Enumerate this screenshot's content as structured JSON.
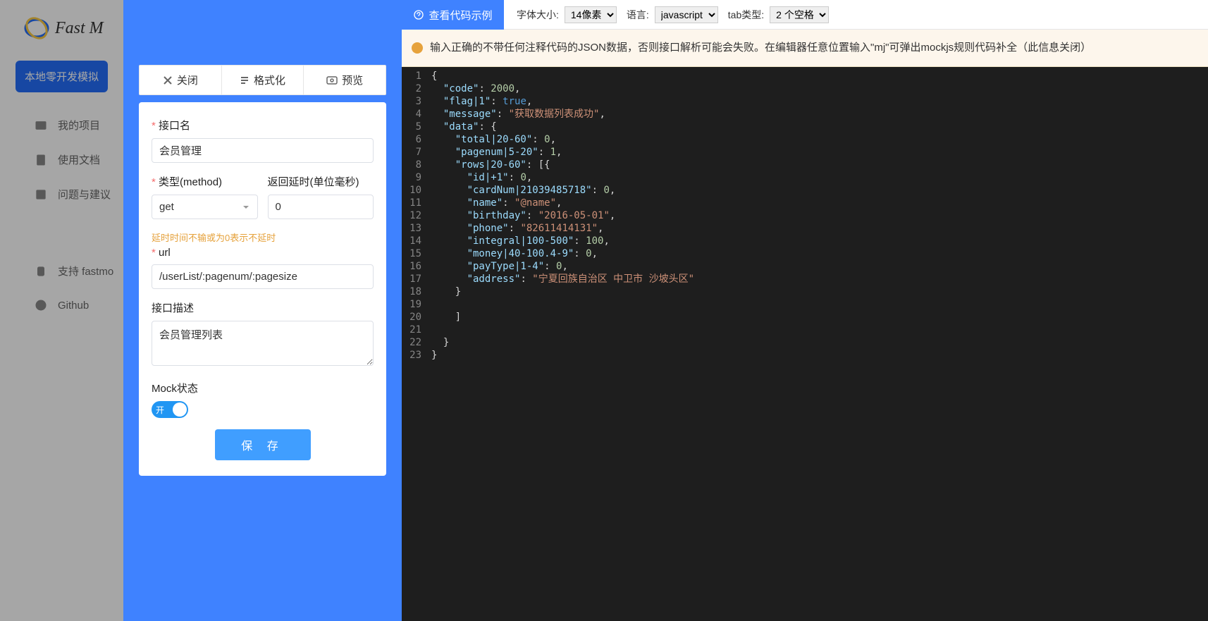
{
  "brand": {
    "name": "Fast M"
  },
  "sidebar": {
    "primary_btn": "本地零开发模拟",
    "items": [
      {
        "label": "我的项目"
      },
      {
        "label": "使用文档"
      },
      {
        "label": "问题与建议"
      },
      {
        "label": "支持 fastmo"
      },
      {
        "label": "Github"
      }
    ]
  },
  "drawer": {
    "toolbar": {
      "close": "关闭",
      "format": "格式化",
      "preview": "预览"
    },
    "labels": {
      "api_name": "接口名",
      "method": "类型(method)",
      "delay": "返回延时(单位毫秒)",
      "delay_hint": "延时时间不输或为0表示不延时",
      "url": "url",
      "desc": "接口描述",
      "mock_state": "Mock状态"
    },
    "values": {
      "api_name": "会员管理",
      "method": "get",
      "delay": "0",
      "url": "/userList/:pagenum/:pagesize",
      "desc": "会员管理列表",
      "switch_text": "开"
    },
    "save": "保 存"
  },
  "topbar": {
    "example_btn": "查看代码示例",
    "font_label": "字体大小:",
    "font_value": "14像素",
    "lang_label": "语言:",
    "lang_value": "javascript",
    "tab_label": "tab类型:",
    "tab_value": "2 个空格"
  },
  "warning": "输入正确的不带任何注释代码的JSON数据，否则接口解析可能会失败。在编辑器任意位置输入\"mj\"可弹出mockjs规则代码补全（此信息关闭）",
  "code_lines": [
    "{",
    "  \"code\": 2000,",
    "  \"flag|1\": true,",
    "  \"message\": \"获取数据列表成功\",",
    "  \"data\": {",
    "    \"total|20-60\": 0,",
    "    \"pagenum|5-20\": 1,",
    "    \"rows|20-60\": [{",
    "      \"id|+1\": 0,",
    "      \"cardNum|21039485718\": 0,",
    "      \"name\": \"@name\",",
    "      \"birthday\": \"2016-05-01\",",
    "      \"phone\": \"82611414131\",",
    "      \"integral|100-500\": 100,",
    "      \"money|40-100.4-9\": 0,",
    "      \"payType|1-4\": 0,",
    "      \"address\": \"宁夏回族自治区 中卫市 沙坡头区\"",
    "    }",
    "",
    "    ]",
    "",
    "  }",
    "}"
  ]
}
